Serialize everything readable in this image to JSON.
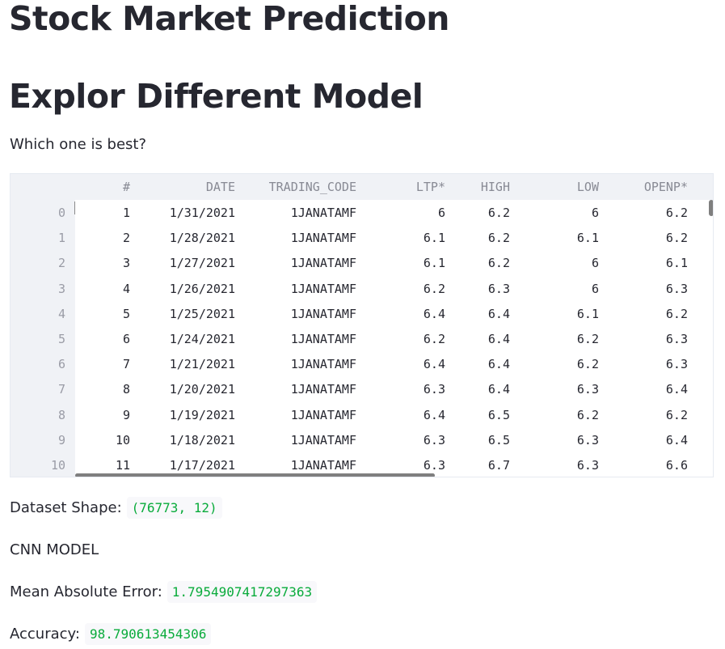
{
  "title": "Stock Market Prediction",
  "subtitle": "Explor Different Model",
  "question": "Which one is best?",
  "table": {
    "columns": [
      "#",
      "DATE",
      "TRADING_CODE",
      "LTP*",
      "HIGH",
      "LOW",
      "OPENP*"
    ],
    "rows": [
      {
        "index": "0",
        "cells": [
          "1",
          "1/31/2021",
          "1JANATAMF",
          "6",
          "6.2",
          "6",
          "6.2"
        ]
      },
      {
        "index": "1",
        "cells": [
          "2",
          "1/28/2021",
          "1JANATAMF",
          "6.1",
          "6.2",
          "6.1",
          "6.2"
        ]
      },
      {
        "index": "2",
        "cells": [
          "3",
          "1/27/2021",
          "1JANATAMF",
          "6.1",
          "6.2",
          "6",
          "6.1"
        ]
      },
      {
        "index": "3",
        "cells": [
          "4",
          "1/26/2021",
          "1JANATAMF",
          "6.2",
          "6.3",
          "6",
          "6.3"
        ]
      },
      {
        "index": "4",
        "cells": [
          "5",
          "1/25/2021",
          "1JANATAMF",
          "6.4",
          "6.4",
          "6.1",
          "6.2"
        ]
      },
      {
        "index": "5",
        "cells": [
          "6",
          "1/24/2021",
          "1JANATAMF",
          "6.2",
          "6.4",
          "6.2",
          "6.3"
        ]
      },
      {
        "index": "6",
        "cells": [
          "7",
          "1/21/2021",
          "1JANATAMF",
          "6.4",
          "6.4",
          "6.2",
          "6.3"
        ]
      },
      {
        "index": "7",
        "cells": [
          "8",
          "1/20/2021",
          "1JANATAMF",
          "6.3",
          "6.4",
          "6.3",
          "6.4"
        ]
      },
      {
        "index": "8",
        "cells": [
          "9",
          "1/19/2021",
          "1JANATAMF",
          "6.4",
          "6.5",
          "6.2",
          "6.2"
        ]
      },
      {
        "index": "9",
        "cells": [
          "10",
          "1/18/2021",
          "1JANATAMF",
          "6.3",
          "6.5",
          "6.3",
          "6.4"
        ]
      },
      {
        "index": "10",
        "cells": [
          "11",
          "1/17/2021",
          "1JANATAMF",
          "6.3",
          "6.7",
          "6.3",
          "6.6"
        ]
      }
    ]
  },
  "shape_label": "Dataset Shape:",
  "shape_value": "(76773, 12)",
  "model_label": "CNN MODEL",
  "mae_label": "Mean Absolute Error:",
  "mae_value": "1.7954907417297363",
  "accuracy_label": "Accuracy:",
  "accuracy_value": "98.790613454306",
  "colors": {
    "text": "#262730",
    "code_text": "#09ab3b",
    "code_bg": "#f8f8fb",
    "table_header_bg": "#f0f2f6"
  }
}
